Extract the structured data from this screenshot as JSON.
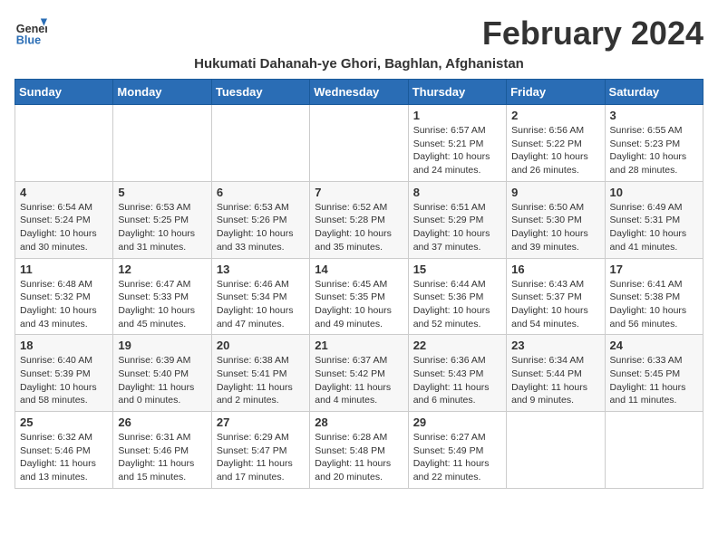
{
  "header": {
    "logo_general": "General",
    "logo_blue": "Blue",
    "month_title": "February 2024",
    "subtitle": "Hukumati Dahanah-ye Ghori, Baghlan, Afghanistan"
  },
  "weekdays": [
    "Sunday",
    "Monday",
    "Tuesday",
    "Wednesday",
    "Thursday",
    "Friday",
    "Saturday"
  ],
  "weeks": [
    [
      {
        "day": "",
        "info": ""
      },
      {
        "day": "",
        "info": ""
      },
      {
        "day": "",
        "info": ""
      },
      {
        "day": "",
        "info": ""
      },
      {
        "day": "1",
        "info": "Sunrise: 6:57 AM\nSunset: 5:21 PM\nDaylight: 10 hours\nand 24 minutes."
      },
      {
        "day": "2",
        "info": "Sunrise: 6:56 AM\nSunset: 5:22 PM\nDaylight: 10 hours\nand 26 minutes."
      },
      {
        "day": "3",
        "info": "Sunrise: 6:55 AM\nSunset: 5:23 PM\nDaylight: 10 hours\nand 28 minutes."
      }
    ],
    [
      {
        "day": "4",
        "info": "Sunrise: 6:54 AM\nSunset: 5:24 PM\nDaylight: 10 hours\nand 30 minutes."
      },
      {
        "day": "5",
        "info": "Sunrise: 6:53 AM\nSunset: 5:25 PM\nDaylight: 10 hours\nand 31 minutes."
      },
      {
        "day": "6",
        "info": "Sunrise: 6:53 AM\nSunset: 5:26 PM\nDaylight: 10 hours\nand 33 minutes."
      },
      {
        "day": "7",
        "info": "Sunrise: 6:52 AM\nSunset: 5:28 PM\nDaylight: 10 hours\nand 35 minutes."
      },
      {
        "day": "8",
        "info": "Sunrise: 6:51 AM\nSunset: 5:29 PM\nDaylight: 10 hours\nand 37 minutes."
      },
      {
        "day": "9",
        "info": "Sunrise: 6:50 AM\nSunset: 5:30 PM\nDaylight: 10 hours\nand 39 minutes."
      },
      {
        "day": "10",
        "info": "Sunrise: 6:49 AM\nSunset: 5:31 PM\nDaylight: 10 hours\nand 41 minutes."
      }
    ],
    [
      {
        "day": "11",
        "info": "Sunrise: 6:48 AM\nSunset: 5:32 PM\nDaylight: 10 hours\nand 43 minutes."
      },
      {
        "day": "12",
        "info": "Sunrise: 6:47 AM\nSunset: 5:33 PM\nDaylight: 10 hours\nand 45 minutes."
      },
      {
        "day": "13",
        "info": "Sunrise: 6:46 AM\nSunset: 5:34 PM\nDaylight: 10 hours\nand 47 minutes."
      },
      {
        "day": "14",
        "info": "Sunrise: 6:45 AM\nSunset: 5:35 PM\nDaylight: 10 hours\nand 49 minutes."
      },
      {
        "day": "15",
        "info": "Sunrise: 6:44 AM\nSunset: 5:36 PM\nDaylight: 10 hours\nand 52 minutes."
      },
      {
        "day": "16",
        "info": "Sunrise: 6:43 AM\nSunset: 5:37 PM\nDaylight: 10 hours\nand 54 minutes."
      },
      {
        "day": "17",
        "info": "Sunrise: 6:41 AM\nSunset: 5:38 PM\nDaylight: 10 hours\nand 56 minutes."
      }
    ],
    [
      {
        "day": "18",
        "info": "Sunrise: 6:40 AM\nSunset: 5:39 PM\nDaylight: 10 hours\nand 58 minutes."
      },
      {
        "day": "19",
        "info": "Sunrise: 6:39 AM\nSunset: 5:40 PM\nDaylight: 11 hours\nand 0 minutes."
      },
      {
        "day": "20",
        "info": "Sunrise: 6:38 AM\nSunset: 5:41 PM\nDaylight: 11 hours\nand 2 minutes."
      },
      {
        "day": "21",
        "info": "Sunrise: 6:37 AM\nSunset: 5:42 PM\nDaylight: 11 hours\nand 4 minutes."
      },
      {
        "day": "22",
        "info": "Sunrise: 6:36 AM\nSunset: 5:43 PM\nDaylight: 11 hours\nand 6 minutes."
      },
      {
        "day": "23",
        "info": "Sunrise: 6:34 AM\nSunset: 5:44 PM\nDaylight: 11 hours\nand 9 minutes."
      },
      {
        "day": "24",
        "info": "Sunrise: 6:33 AM\nSunset: 5:45 PM\nDaylight: 11 hours\nand 11 minutes."
      }
    ],
    [
      {
        "day": "25",
        "info": "Sunrise: 6:32 AM\nSunset: 5:46 PM\nDaylight: 11 hours\nand 13 minutes."
      },
      {
        "day": "26",
        "info": "Sunrise: 6:31 AM\nSunset: 5:46 PM\nDaylight: 11 hours\nand 15 minutes."
      },
      {
        "day": "27",
        "info": "Sunrise: 6:29 AM\nSunset: 5:47 PM\nDaylight: 11 hours\nand 17 minutes."
      },
      {
        "day": "28",
        "info": "Sunrise: 6:28 AM\nSunset: 5:48 PM\nDaylight: 11 hours\nand 20 minutes."
      },
      {
        "day": "29",
        "info": "Sunrise: 6:27 AM\nSunset: 5:49 PM\nDaylight: 11 hours\nand 22 minutes."
      },
      {
        "day": "",
        "info": ""
      },
      {
        "day": "",
        "info": ""
      }
    ]
  ]
}
